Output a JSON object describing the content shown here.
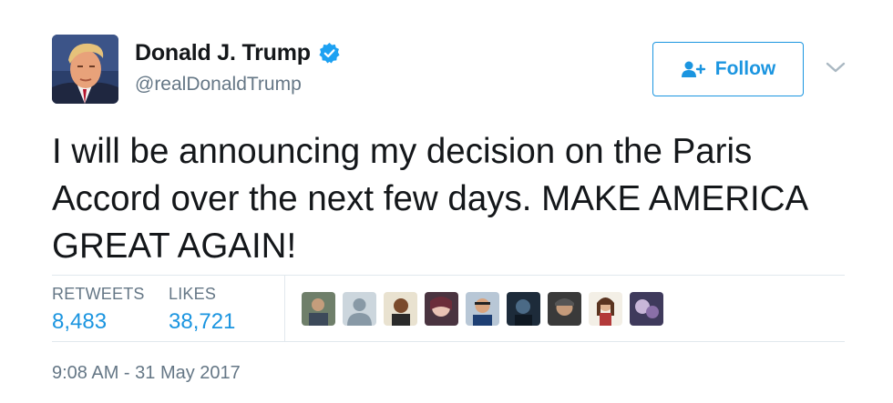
{
  "user": {
    "display_name": "Donald J. Trump",
    "handle": "@realDonaldTrump",
    "verified": true,
    "avatar_icon": "profile-photo"
  },
  "actions": {
    "follow_label": "Follow",
    "follow_icon": "follow-user-icon",
    "caret_icon": "chevron-down-icon"
  },
  "tweet": {
    "text": "I will be announcing my decision on the Paris Accord over the next few days. MAKE AMERICA GREAT AGAIN!"
  },
  "stats": {
    "retweets_label": "RETWEETS",
    "retweets_value": "8,483",
    "likes_label": "LIKES",
    "likes_value": "38,721"
  },
  "likers": [
    "liker-avatar-1",
    "liker-avatar-2",
    "liker-avatar-3",
    "liker-avatar-4",
    "liker-avatar-5",
    "liker-avatar-6",
    "liker-avatar-7",
    "liker-avatar-8",
    "liker-avatar-9"
  ],
  "timestamp": "9:08 AM - 31 May 2017",
  "colors": {
    "accent": "#1b95e0",
    "text": "#14171a",
    "muted": "#657786",
    "divider": "#e1e8ed"
  }
}
